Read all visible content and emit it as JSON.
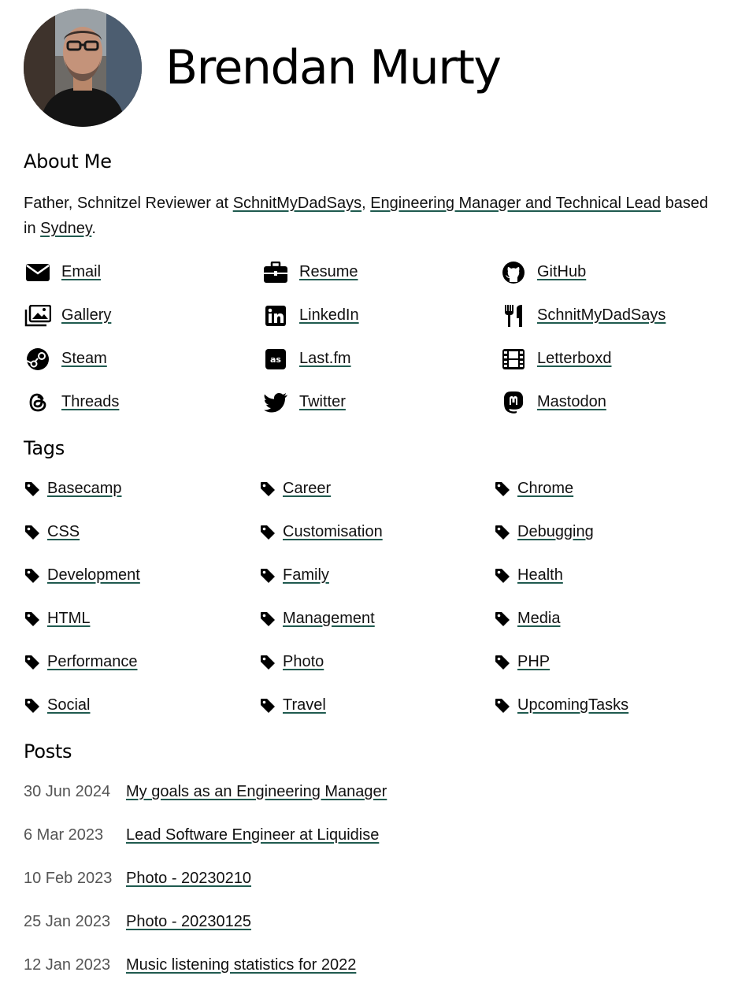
{
  "profile": {
    "name": "Brendan Murty",
    "avatar_alt": "Brendan Murty profile photo"
  },
  "about": {
    "heading": "About Me",
    "text_1": "Father, Schnitzel Reviewer at ",
    "link_1": "SchnitMyDadSays",
    "text_2": ", ",
    "link_2": "Engineering Manager and Technical Lead",
    "text_3": " based in ",
    "link_3": "Sydney",
    "text_4": "."
  },
  "social_links": [
    {
      "label": "Email",
      "icon": "envelope-icon"
    },
    {
      "label": "Resume",
      "icon": "briefcase-icon"
    },
    {
      "label": "GitHub",
      "icon": "github-icon"
    },
    {
      "label": "Gallery",
      "icon": "gallery-icon"
    },
    {
      "label": "LinkedIn",
      "icon": "linkedin-icon"
    },
    {
      "label": "SchnitMyDadSays",
      "icon": "utensils-icon"
    },
    {
      "label": "Steam",
      "icon": "steam-icon"
    },
    {
      "label": "Last.fm",
      "icon": "lastfm-icon"
    },
    {
      "label": "Letterboxd",
      "icon": "film-icon"
    },
    {
      "label": "Threads",
      "icon": "threads-icon"
    },
    {
      "label": "Twitter",
      "icon": "twitter-icon"
    },
    {
      "label": "Mastodon",
      "icon": "mastodon-icon"
    }
  ],
  "tags": {
    "heading": "Tags",
    "items": [
      "Basecamp",
      "Career",
      "Chrome",
      "CSS",
      "Customisation",
      "Debugging",
      "Development",
      "Family",
      "Health",
      "HTML",
      "Management",
      "Media",
      "Performance",
      "Photo",
      "PHP",
      "Social",
      "Travel",
      "UpcomingTasks"
    ]
  },
  "posts": {
    "heading": "Posts",
    "items": [
      {
        "date": "30 Jun 2024",
        "title": "My goals as an Engineering Manager"
      },
      {
        "date": "6 Mar 2023",
        "title": "Lead Software Engineer at Liquidise"
      },
      {
        "date": "10 Feb 2023",
        "title": "Photo - 20230210"
      },
      {
        "date": "25 Jan 2023",
        "title": "Photo - 20230125"
      },
      {
        "date": "12 Jan 2023",
        "title": "Music listening statistics for 2022"
      }
    ]
  },
  "colors": {
    "link_underline": "#1f5a4f",
    "text": "#111111",
    "date": "#555555"
  }
}
